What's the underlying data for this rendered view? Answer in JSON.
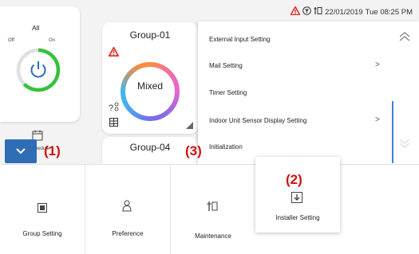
{
  "status_bar": {
    "date": "22/01/2019",
    "time": "Tue 08:25 PM",
    "icons": [
      "warning-icon",
      "filter-sign-icon",
      "maintenance-icon"
    ]
  },
  "all_control": {
    "title": "All",
    "off_label": "Off",
    "on_label": "On",
    "icon": "power-icon"
  },
  "schedule": {
    "label": "Schedule",
    "icon": "calendar-icon"
  },
  "groups": [
    {
      "name": "Group-01",
      "mode": "Mixed"
    },
    {
      "name": "Group-04"
    }
  ],
  "installer_menu": {
    "items": [
      {
        "label": "External Input Setting"
      },
      {
        "label": "Mail Setting",
        "chevron": ">"
      },
      {
        "label": "Timer Setting"
      },
      {
        "label": "Indoor Unit Sensor Display Setting",
        "chevron": ">"
      },
      {
        "label": "Initialization"
      }
    ]
  },
  "bottom_tabs": [
    {
      "label": "Group Setting",
      "icon": "group-setting-icon"
    },
    {
      "label": "Preference",
      "icon": "preference-icon"
    },
    {
      "label": "Maintenance",
      "icon": "maintenance-icon"
    },
    {
      "label": "Installer Setting",
      "icon": "installer-setting-icon",
      "active": true
    }
  ],
  "callouts": [
    "(1)",
    "(2)",
    "(3)"
  ],
  "colors": {
    "accent_blue": "#2f6db5",
    "scroll_blue": "#3a83d6",
    "power_green": "#35c23a",
    "warning_red": "#e0342c",
    "callout_red": "#d01010"
  }
}
